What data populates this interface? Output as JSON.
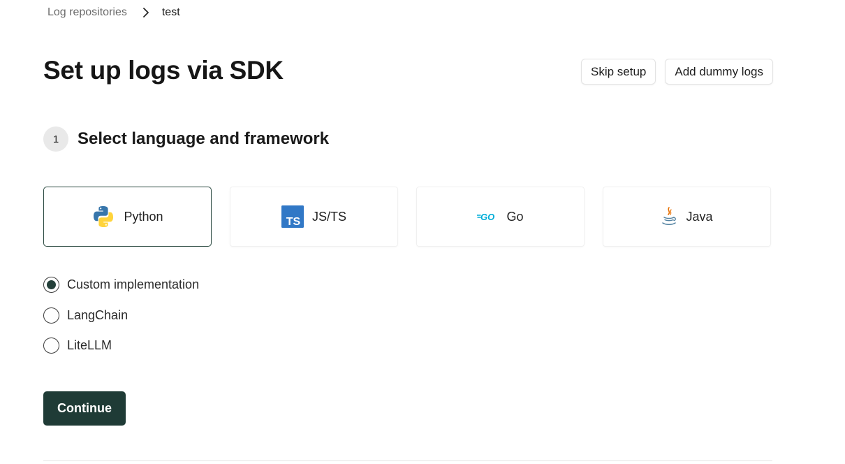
{
  "breadcrumb": {
    "parent": "Log repositories",
    "current": "test"
  },
  "page": {
    "title": "Set up logs via SDK"
  },
  "actions": {
    "skip_label": "Skip setup",
    "dummy_label": "Add dummy logs"
  },
  "step": {
    "number": "1",
    "title": "Select language and framework"
  },
  "languages": [
    {
      "label": "Python",
      "icon": "python-icon",
      "selected": true
    },
    {
      "label": "JS/TS",
      "icon": "typescript-icon",
      "selected": false
    },
    {
      "label": "Go",
      "icon": "go-icon",
      "selected": false
    },
    {
      "label": "Java",
      "icon": "java-icon",
      "selected": false
    }
  ],
  "frameworks": [
    {
      "label": "Custom implementation",
      "checked": true
    },
    {
      "label": "LangChain",
      "checked": false
    },
    {
      "label": "LiteLLM",
      "checked": false
    }
  ],
  "continue_label": "Continue",
  "colors": {
    "accent": "#1f3b36",
    "selected_border": "#2b4a41",
    "typescript": "#3178c6",
    "go": "#00add8",
    "python_blue": "#3776ab",
    "python_yellow": "#ffd43b"
  }
}
